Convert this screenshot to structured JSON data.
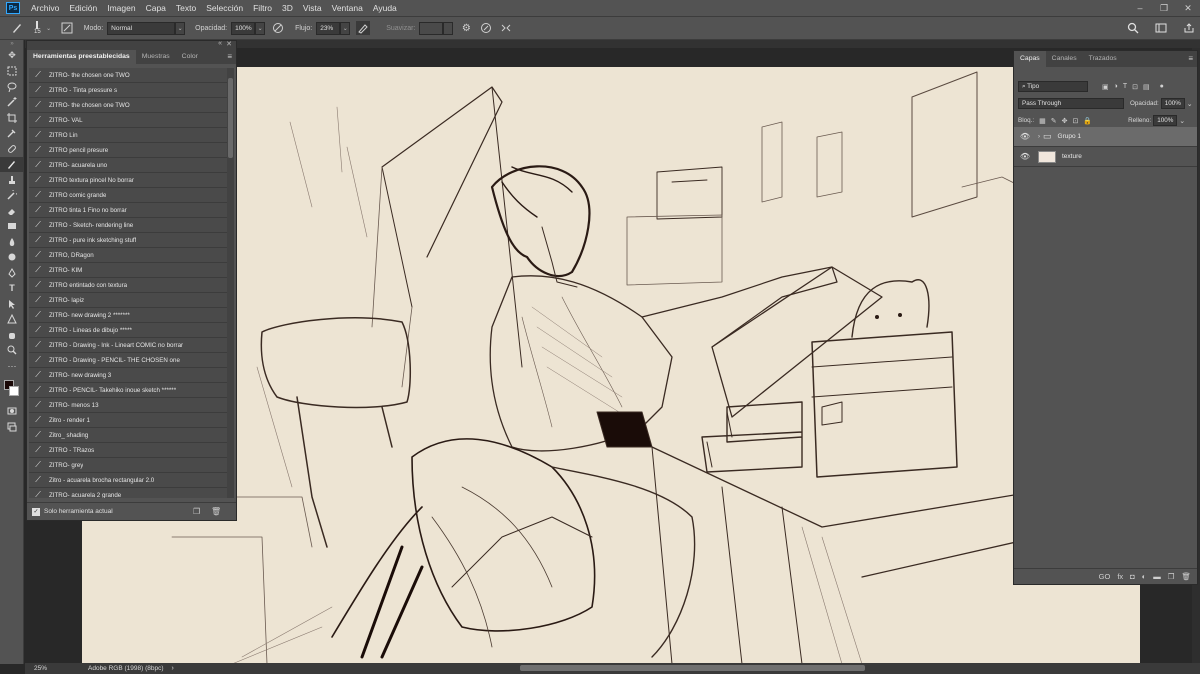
{
  "app": {
    "logo": "Ps"
  },
  "menu": [
    "Archivo",
    "Edición",
    "Imagen",
    "Capa",
    "Texto",
    "Selección",
    "Filtro",
    "3D",
    "Vista",
    "Ventana",
    "Ayuda"
  ],
  "window_controls": {
    "minimize": "–",
    "restore": "❐",
    "close": "✕"
  },
  "options": {
    "brush_size": "15",
    "mode_label": "Modo:",
    "mode_value": "Normal",
    "opacity_label": "Opacidad:",
    "opacity_value": "100%",
    "flow_label": "Flujo:",
    "flow_value": "23%",
    "smoothing_label": "Suavizar:",
    "smoothing_value": ""
  },
  "presets_panel": {
    "tabs": [
      "Herramientas preestablecidas",
      "Muestras",
      "Color"
    ],
    "items": [
      "ZITRO- the chosen one TWO",
      "ZITRO - Tinta pressure s",
      "ZITRO- the chosen one TWO",
      "ZITRO- VAL",
      "ZITRO Lin",
      "ZITRO pencil presure",
      "ZITRO- acuarela uno",
      "ZITRO textura pincel No borrar",
      "ZITRO comic grande",
      "ZITRO tinta 1 Fino no borrar",
      "ZITRO - Sketch- rendering line",
      "ZITRO - pure ink sketching stuff",
      "ZITRO, DRagon",
      "ZITRO- KIM",
      "ZITRO entintado con textura",
      "ZITRO- lapiz",
      "ZITRO- new drawing 2 *******",
      "ZITRO - Lineas de dibujo *****",
      "ZITRO - Drawing - Ink - Lineart COMIC no borrar",
      "ZITRO - Drawing - PENCIL- THE CHOSEN one",
      "ZITRO- new drawing 3",
      "ZITRO - PENCIL- Takehiko inoue sketch ******",
      "ZITRO- menos 13",
      "Zitro - render 1",
      "Zitro_ shading",
      "ZITRO - TRazos",
      "ZITRO- grey",
      "Zitro - acuarela brocha rectangular 2.0",
      "ZITRO- acuarela 2 grande"
    ],
    "footer_checkbox_label": "Solo herramienta actual"
  },
  "layers_panel": {
    "tabs": [
      "Capas",
      "Canales",
      "Trazados"
    ],
    "filter_value": "Tipo",
    "blend_mode": "Pass Through",
    "opacity_label": "Opacidad:",
    "opacity_value": "100%",
    "lock_label": "Bloq.:",
    "fill_label": "Relleno:",
    "fill_value": "100%",
    "layers": [
      {
        "name": "Grupo 1",
        "type": "group",
        "selected": true
      },
      {
        "name": "texture",
        "type": "layer",
        "selected": false
      }
    ],
    "footer_icons": [
      "GO",
      "fx",
      "◘",
      "◐",
      "▬",
      "❐",
      "🗑"
    ]
  },
  "status": {
    "zoom": "25%",
    "doc_info": "Adobe RGB (1998) (8bpc)"
  },
  "colors": {
    "foreground": "#1a0806",
    "background": "#ffffff",
    "canvas": "#ede4d3"
  }
}
